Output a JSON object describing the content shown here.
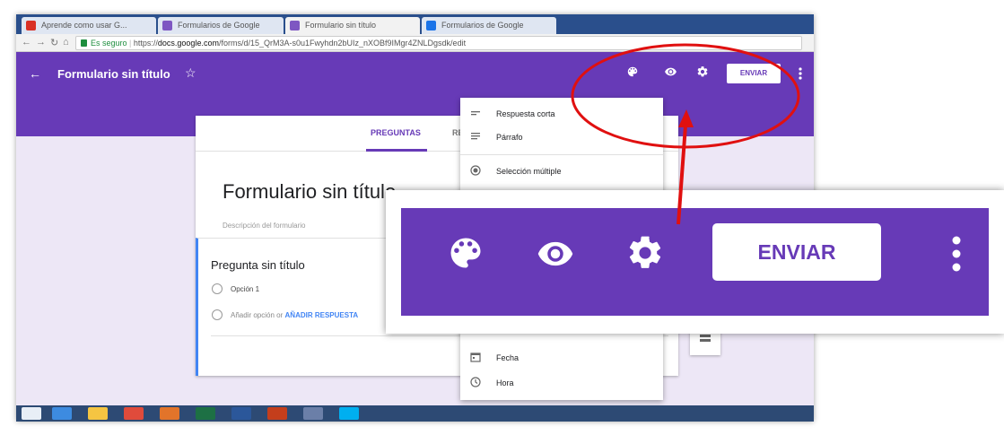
{
  "browser": {
    "tabs": [
      {
        "label": "Aprende como usar G...",
        "color": "#d93025"
      },
      {
        "label": "Formularios de Google",
        "color": "#7e57c2"
      },
      {
        "label": "Formulario sin título",
        "color": "#7e57c2"
      },
      {
        "label": "Formularios de Google",
        "color": "#1a73e8"
      }
    ],
    "secure_label": "Es seguro",
    "url_prefix": "https://",
    "url_domain": "docs.google.com",
    "url_path": "/forms/d/15_QrM3A-s0u1Fwyhdn2bUIz_nXOBf9IMgr4ZNLDgsdk/edit"
  },
  "header": {
    "title": "Formulario sin título",
    "send_label": "ENVIAR",
    "bg_color": "#673ab7",
    "icons": [
      "palette-icon",
      "eye-icon",
      "gear-icon",
      "more-vert-icon"
    ]
  },
  "form": {
    "tab_questions": "PREGUNTAS",
    "tab_responses": "RE",
    "title": "Formulario sin título",
    "description_placeholder": "Descripción del formulario",
    "question_title": "Pregunta sin título",
    "option1": "Opción 1",
    "add_option": "Añadir opción",
    "add_or": "or",
    "add_other": "AÑADIR RESPUESTA"
  },
  "question_type_menu": {
    "items_top": [
      {
        "label": "Respuesta corta",
        "icon": "short-text-icon"
      },
      {
        "label": "Párrafo",
        "icon": "paragraph-icon"
      },
      {
        "label": "Selección múltiple",
        "icon": "radio-icon"
      }
    ],
    "items_bottom": [
      {
        "label": "Fecha",
        "icon": "calendar-icon"
      },
      {
        "label": "Hora",
        "icon": "clock-icon"
      }
    ]
  },
  "zoom_callout": {
    "send_label": "ENVIAR",
    "icons": [
      "palette-icon",
      "eye-icon",
      "gear-icon",
      "more-vert-icon"
    ]
  },
  "annotation": {
    "color": "#e01010"
  }
}
